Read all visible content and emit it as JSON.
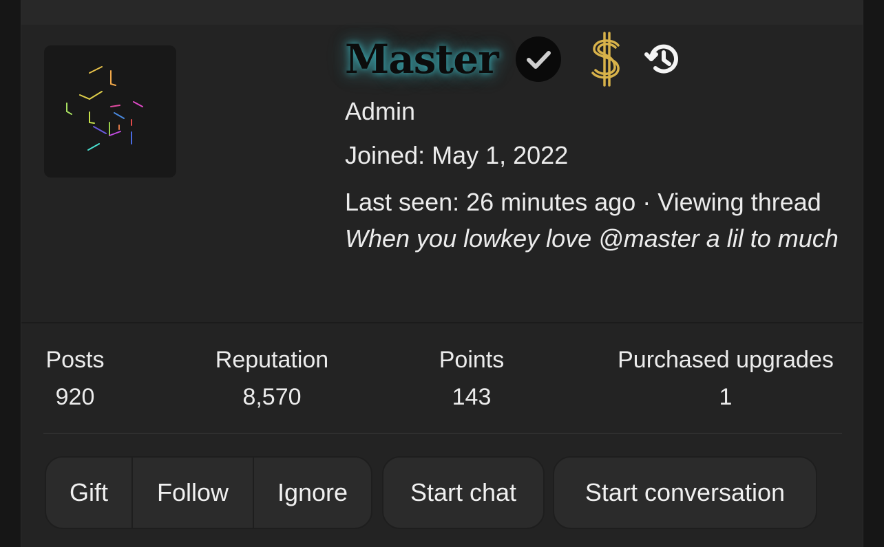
{
  "profile": {
    "username": "Master",
    "title": "Admin",
    "joined": "Joined: May 1, 2022",
    "last_seen_prefix": "Last seen: 26 minutes ago · Viewing thread ",
    "last_seen_thread": "When you lowkey love @master a lil to much"
  },
  "icons": {
    "verified": "verified-check-icon",
    "upgrade": "dollar-sign-icon",
    "history": "history-icon"
  },
  "colors": {
    "username_glow": "#40bec8",
    "dollar_gold": "#d8b24a"
  },
  "stats": [
    {
      "label": "Posts",
      "value": "920"
    },
    {
      "label": "Reputation",
      "value": "8,570"
    },
    {
      "label": "Points",
      "value": "143"
    },
    {
      "label": "Purchased upgrades",
      "value": "1"
    }
  ],
  "actions": {
    "gift": "Gift",
    "follow": "Follow",
    "ignore": "Ignore",
    "start_chat": "Start chat",
    "start_conversation": "Start conversation"
  }
}
